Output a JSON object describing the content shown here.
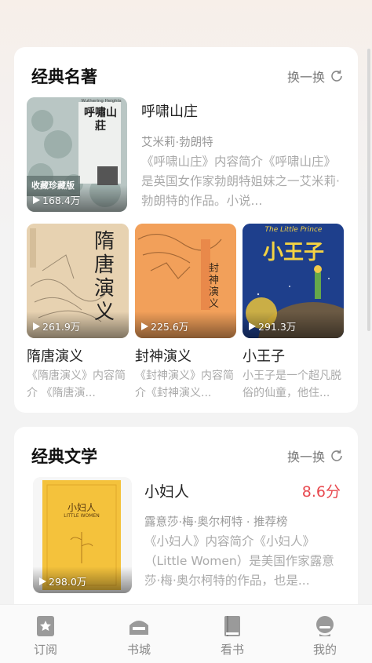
{
  "section1": {
    "title": "经典名著",
    "refresh_label": "换一换",
    "featured": {
      "name": "呼啸山庄",
      "author": "艾米莉·勃朗特",
      "desc": "《呼啸山庄》内容简介《呼啸山庄》是英国女作家勃朗特姐妹之一艾米莉·勃朗特的作品。小说...",
      "plays": "168.4万",
      "cover_text_main": "呼嘯山莊",
      "cover_text_sub": "Wuthering Heights",
      "cover_text_label": "收藏珍藏版"
    },
    "books": [
      {
        "name": "隋唐演义",
        "desc": "《隋唐演义》内容简介 《隋唐演...",
        "plays": "261.9万",
        "cover_text": "隋唐演义"
      },
      {
        "name": "封神演义",
        "desc": "《封神演义》内容简介《封神演义...",
        "plays": "225.6万",
        "cover_text": "封神演义"
      },
      {
        "name": "小王子",
        "desc": "小王子是一个超凡脱俗的仙童，他住...",
        "plays": "291.3万",
        "cover_text": "小王子",
        "cover_text_en": "The Little Prince"
      }
    ]
  },
  "section2": {
    "title": "经典文学",
    "refresh_label": "换一换",
    "featured": {
      "name": "小妇人",
      "score": "8.6分",
      "author_line": "露意莎·梅·奥尔柯特 · 推荐榜",
      "desc": "《小妇人》内容简介《小妇人》（Little Women）是美国作家露意莎·梅·奥尔柯特的作品，也是...",
      "plays": "298.0万",
      "cover_text": "小妇人",
      "cover_text_en": "LITTLE WOMEN"
    }
  },
  "tabbar": {
    "items": [
      {
        "label": "订阅",
        "icon": "subscribe-icon"
      },
      {
        "label": "书城",
        "icon": "bookstore-icon"
      },
      {
        "label": "看书",
        "icon": "read-book-icon"
      },
      {
        "label": "我的",
        "icon": "profile-icon"
      }
    ]
  },
  "colors": {
    "accent_red": "#e8484e",
    "text_gray": "#aaaaaa"
  }
}
